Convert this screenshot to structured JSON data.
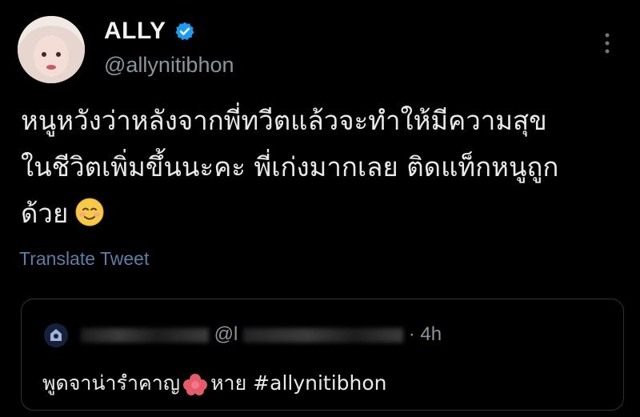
{
  "tweet": {
    "display_name": "ALLY",
    "handle": "@allynitibhon",
    "text": "หนูหวังว่าหลังจากพี่ทวีตแล้วจะทำให้มีความสุข\nในชีวิตเพิ่มขึ้นนะคะ พี่เก่งมากเลย ติดแท็กหนูถูก\nด้วย",
    "translate_label": "Translate Tweet",
    "verified_color": "#1d9bf0"
  },
  "quote": {
    "handle_fragment": "@l",
    "time": "· 4h",
    "text_start": "พูดจาน่ารำคาญ",
    "text_end": "หาย #allynitibhon"
  },
  "icons": {
    "verified": "verified-badge-icon",
    "more": "more-vertical-icon",
    "emoji": "smiling-face-emoji-icon"
  }
}
